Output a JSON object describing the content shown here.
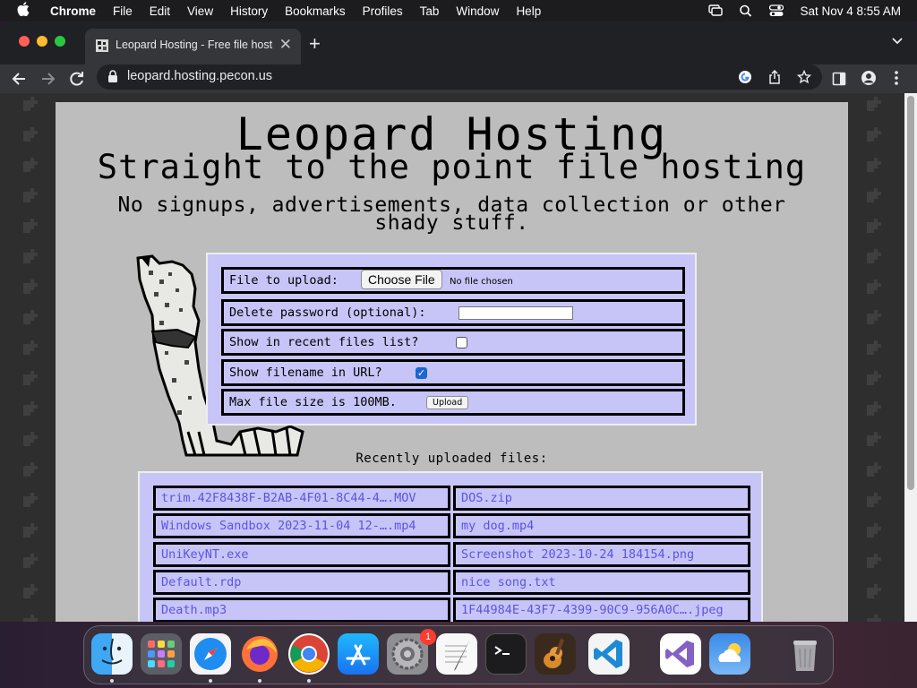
{
  "menubar": {
    "apple": "",
    "app": "Chrome",
    "items": [
      "File",
      "Edit",
      "View",
      "History",
      "Bookmarks",
      "Profiles",
      "Tab",
      "Window",
      "Help"
    ],
    "datetime": "Sat Nov 4  8:55 AM"
  },
  "tab": {
    "title": "Leopard Hosting - Free file hosting",
    "close": "✕"
  },
  "newtab": "+",
  "omnibox": {
    "url": "leopard.hosting.pecon.us"
  },
  "page": {
    "title": "Leopard Hosting",
    "subtitle": "Straight to the point file hosting",
    "tagline": "No signups, advertisements, data collection or other shady stuff.",
    "form": {
      "file_label": "File to upload:",
      "choose_file": "Choose File",
      "no_file": "No file chosen",
      "password_label": "Delete password (optional):",
      "password_value": "",
      "recent_label": "Show in recent files list?",
      "recent_checked": false,
      "filename_label": "Show filename in URL?",
      "filename_checked": true,
      "maxsize_label": "Max file size is 100MB.",
      "upload": "Upload"
    },
    "recent_title": "Recently uploaded files:",
    "recent_files": [
      "trim.42F8438F-B2AB-4F01-8C44-4….MOV",
      "DOS.zip",
      "Windows Sandbox 2023-11-04 12-….mp4",
      "my dog.mp4",
      "UniKeyNT.exe",
      "Screenshot 2023-10-24 184154.png",
      "Default.rdp",
      "nice song.txt",
      "Death.mp3",
      "1F44984E-43F7-4399-90C9-956A0C….jpeg"
    ]
  },
  "dock": {
    "apps": [
      "finder-icon",
      "launchpad-icon",
      "safari-icon",
      "firefox-icon",
      "chrome-icon",
      "app-store-icon",
      "system-settings-icon",
      "textedit-icon",
      "terminal-icon",
      "garageband-icon",
      "vscode-icon",
      "visual-studio-icon",
      "weather-icon",
      "trash-icon"
    ],
    "settings_badge": "1"
  },
  "colors": {
    "page_bg": "#bdbdbd",
    "panel_bg": "#c7c5f8",
    "link": "#5a55e0",
    "chrome_dark": "#202124",
    "chrome_toolbar": "#35363a"
  }
}
